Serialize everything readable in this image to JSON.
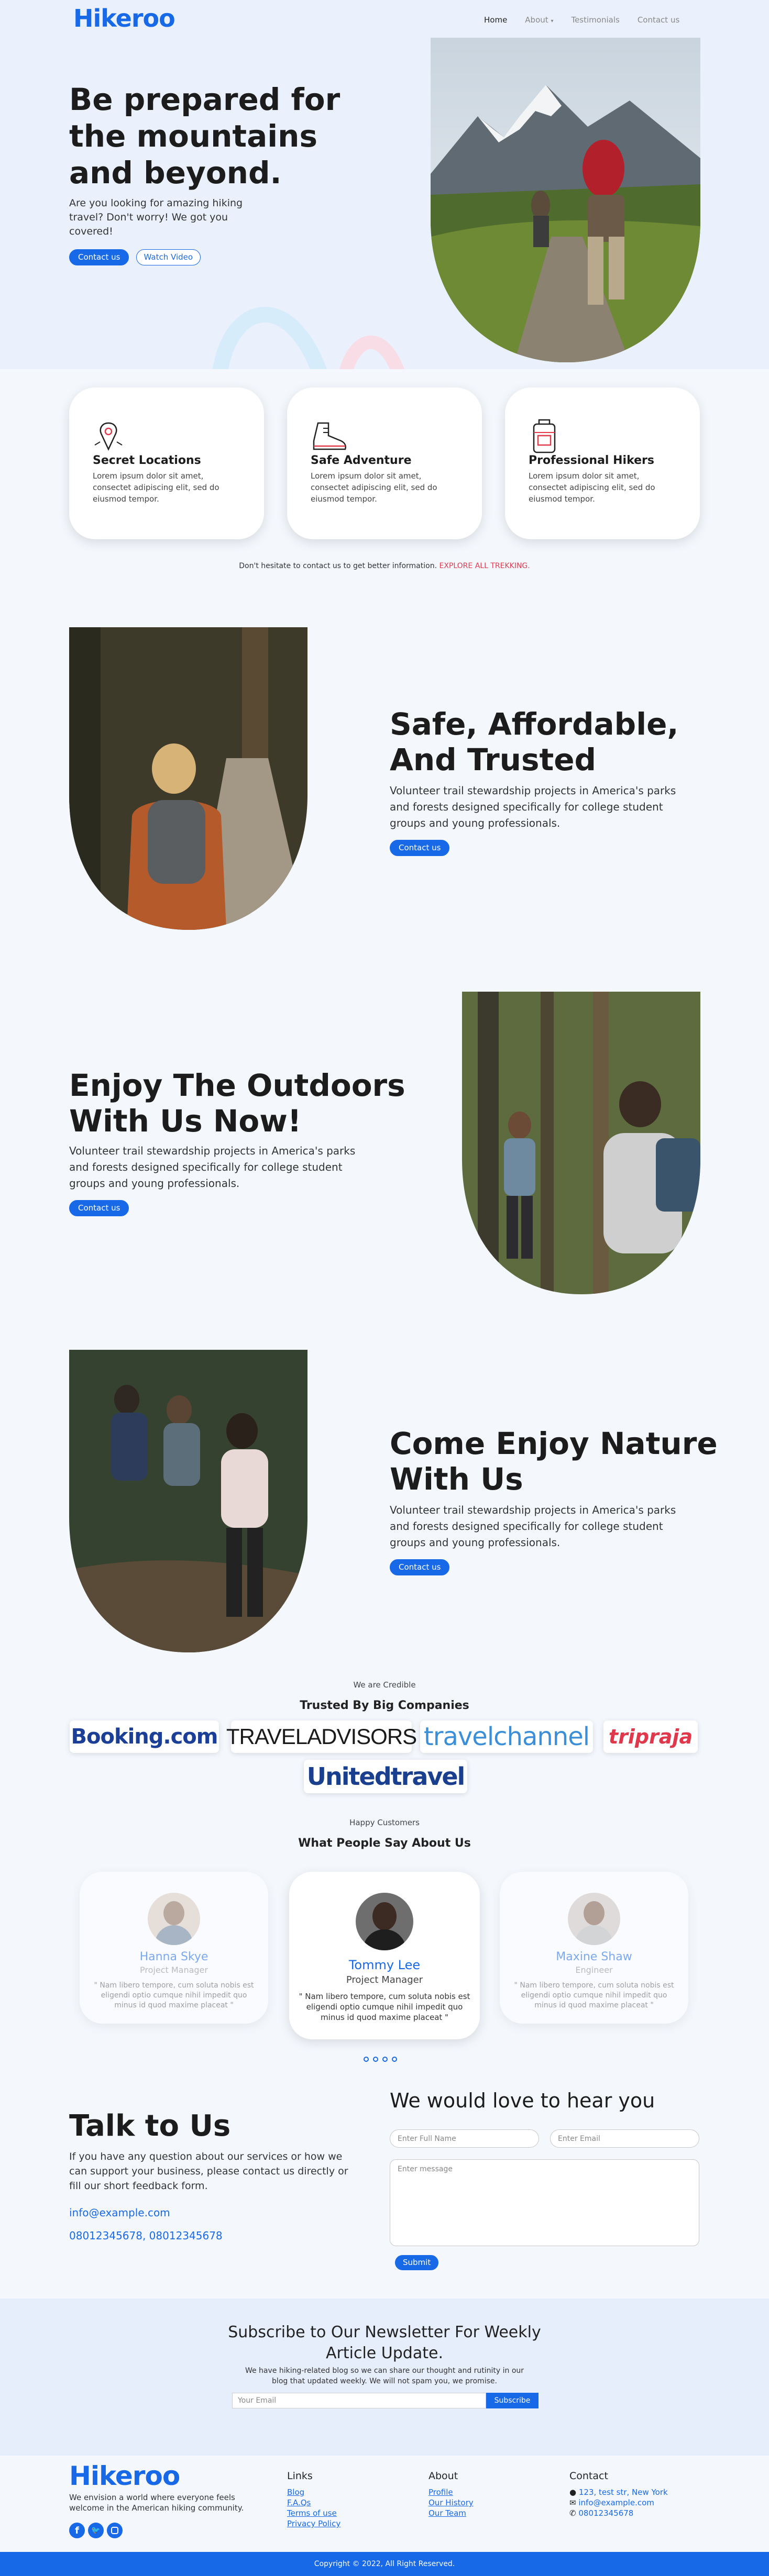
{
  "brand": {
    "logo": "Hikeroo",
    "accent": "#1769e8"
  },
  "nav": {
    "home": "Home",
    "about": "About",
    "testimonials": "Testimonials",
    "contact": "Contact us"
  },
  "hero": {
    "title_l1": "Be prepared for",
    "title_l2": "the mountains",
    "title_l3": "and beyond.",
    "sub_l1": "Are you looking for amazing hiking",
    "sub_l2": "travel? Don't worry! We got you",
    "sub_l3": "covered!",
    "primary_btn": "Contact us",
    "secondary_btn": "Watch Video"
  },
  "features": [
    {
      "icon": "map-pin-icon",
      "title": "Secret Locations",
      "text_l1": "Lorem ipsum dolor sit amet,",
      "text_l2": "consectet adipiscing elit, sed do",
      "text_l3": "eiusmod tempor."
    },
    {
      "icon": "hiking-boot-icon",
      "title": "Safe Adventure",
      "text_l1": "Lorem ipsum dolor sit amet,",
      "text_l2": "consectet adipiscing elit, sed do",
      "text_l3": "eiusmod tempor."
    },
    {
      "icon": "backpack-icon",
      "title": "Professional Hikers",
      "text_l1": "Lorem ipsum dolor sit amet,",
      "text_l2": "consectet adipiscing elit, sed do",
      "text_l3": "eiusmod tempor."
    }
  ],
  "cta_line": {
    "text": "Don't hesitate to contact us to get better information.",
    "link": "EXPLORE ALL TREKKING."
  },
  "sections": [
    {
      "title_l1": "Safe, Affordable,",
      "title_l2": "And Trusted",
      "text_l1": "Volunteer trail stewardship projects in America's parks",
      "text_l2": "and forests designed specifically for college student",
      "text_l3": "groups and young professionals.",
      "btn": "Contact us"
    },
    {
      "title_l1": "Enjoy The Outdoors",
      "title_l2": "With Us Now!",
      "text_l1": "Volunteer trail stewardship projects in America's parks",
      "text_l2": "and forests designed specifically for college student",
      "text_l3": "groups and young professionals.",
      "btn": "Contact us"
    },
    {
      "title_l1": "Come Enjoy Nature",
      "title_l2": "With Us",
      "text_l1": "Volunteer trail stewardship projects in America's parks",
      "text_l2": "and forests designed specifically for college student",
      "text_l3": "groups and young professionals.",
      "btn": "Contact us"
    }
  ],
  "partners": {
    "eyebrow": "We are Credible",
    "title": "Trusted By Big Companies",
    "logos": [
      "Booking.com",
      "TRAVELADVISORS",
      "travelchannel",
      "tripraja",
      "Unitedtravel"
    ]
  },
  "testimonials": {
    "eyebrow": "Happy Customers",
    "title": "What People Say About Us",
    "items": [
      {
        "name": "Hanna Skye",
        "role": "Project Manager",
        "q1": "\" Nam libero tempore, cum soluta nobis est",
        "q2": "eligendi optio cumque nihil impedit quo",
        "q3": "minus id quod maxime placeat \""
      },
      {
        "name": "Tommy Lee",
        "role": "Project Manager",
        "q1": "\" Nam libero tempore, cum soluta nobis est",
        "q2": "eligendi optio cumque nihil impedit quo",
        "q3": "minus id quod maxime placeat \""
      },
      {
        "name": "Maxine Shaw",
        "role": "Engineer",
        "q1": "\" Nam libero tempore, cum soluta nobis est",
        "q2": "eligendi optio cumque nihil impedit quo",
        "q3": "minus id quod maxime placeat \""
      }
    ]
  },
  "contact": {
    "title": "Talk to Us",
    "text_l1": "If you have any question about our services or how we",
    "text_l2": "can support your business, please contact us directly or",
    "text_l3": "fill our short feedback form.",
    "email": "info@example.com",
    "phones": "08012345678, 08012345678",
    "form_title": "We would love to hear you",
    "name_placeholder": "Enter Full Name",
    "email_placeholder": "Enter Email",
    "message_placeholder": "Enter message",
    "submit": "Submit"
  },
  "newsletter": {
    "title_l1": "Subscribe to Our Newsletter For Weekly",
    "title_l2": "Article Update.",
    "text_l1": "We have hiking-related blog so we can share our thought and rutinity in our",
    "text_l2": "blog that updated weekly. We will not spam you, we promise.",
    "placeholder": "Your Email",
    "btn": "Subscribe"
  },
  "footer": {
    "tagline_l1": "We envision a world where everyone feels",
    "tagline_l2": "welcome in the American hiking community.",
    "links_title": "Links",
    "links": [
      "Blog",
      "F.A.Qs",
      "Terms of use",
      "Privacy Policy"
    ],
    "about_title": "About",
    "about": [
      "Profile",
      "Our History",
      "Our Team"
    ],
    "contact_title": "Contact",
    "address": "123, test str, New York",
    "email": "info@example.com",
    "phone": "08012345678",
    "copyright": "Copyright © 2022, All Right Reserved."
  }
}
